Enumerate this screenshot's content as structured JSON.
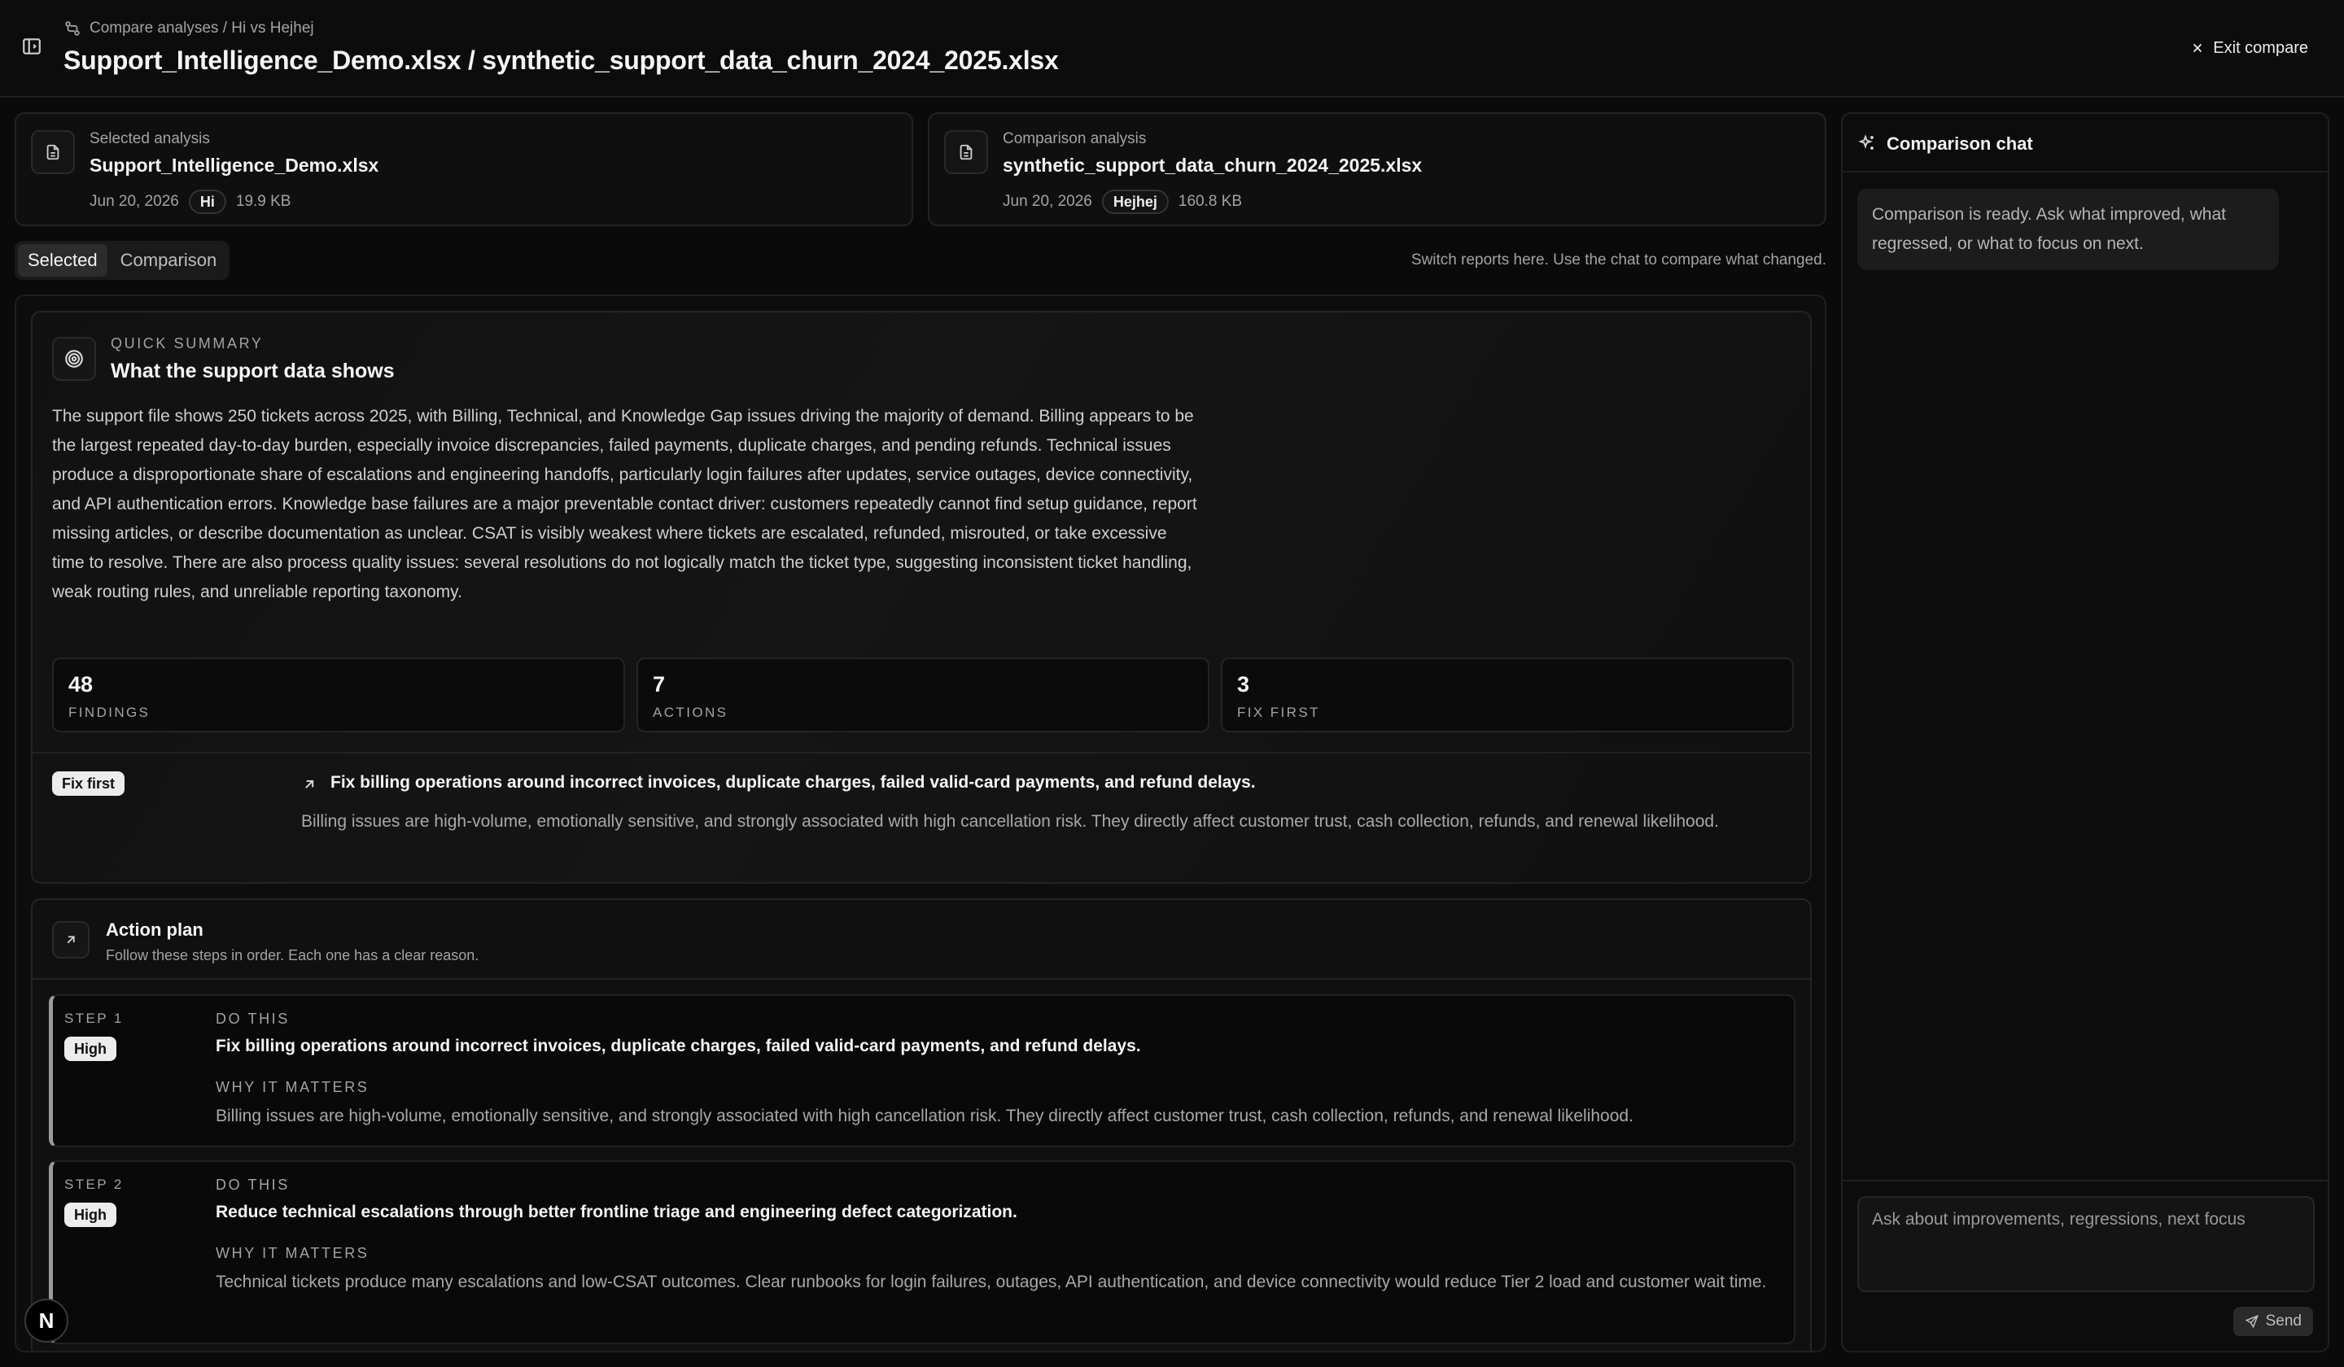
{
  "header": {
    "breadcrumb": "Compare analyses / Hi vs Hejhej",
    "title": "Support_Intelligence_Demo.xlsx / synthetic_support_data_churn_2024_2025.xlsx",
    "exit_label": "Exit compare"
  },
  "selected_analysis": {
    "kind": "Selected analysis",
    "file_name": "Support_Intelligence_Demo.xlsx",
    "date": "Jun 20, 2026",
    "tag": "Hi",
    "size": "19.9 KB"
  },
  "comparison_analysis": {
    "kind": "Comparison analysis",
    "file_name": "synthetic_support_data_churn_2024_2025.xlsx",
    "date": "Jun 20, 2026",
    "tag": "Hejhej",
    "size": "160.8 KB"
  },
  "tabs": {
    "selected": "Selected",
    "comparison": "Comparison",
    "active": "Selected",
    "hint": "Switch reports here. Use the chat to compare what changed."
  },
  "summary": {
    "eyebrow": "QUICK SUMMARY",
    "title": "What the support data shows",
    "body": "The support file shows 250 tickets across 2025, with Billing, Technical, and Knowledge Gap issues driving the majority of demand. Billing appears to be the largest repeated day-to-day burden, especially invoice discrepancies, failed payments, duplicate charges, and pending refunds. Technical issues produce a disproportionate share of escalations and engineering handoffs, particularly login failures after updates, service outages, device connectivity, and API authentication errors. Knowledge base failures are a major preventable contact driver: customers repeatedly cannot find setup guidance, report missing articles, or describe documentation as unclear. CSAT is visibly weakest where tickets are escalated, refunded, misrouted, or take excessive time to resolve. There are also process quality issues: several resolutions do not logically match the ticket type, suggesting inconsistent ticket handling, weak routing rules, and unreliable reporting taxonomy.",
    "stats": [
      {
        "value": "48",
        "label": "FINDINGS"
      },
      {
        "value": "7",
        "label": "ACTIONS"
      },
      {
        "value": "3",
        "label": "FIX FIRST"
      }
    ],
    "fix_first": {
      "badge": "Fix first",
      "title": "Fix billing operations around incorrect invoices, duplicate charges, failed valid-card payments, and refund delays.",
      "body": "Billing issues are high-volume, emotionally sensitive, and strongly associated with high cancellation risk. They directly affect customer trust, cash collection, refunds, and renewal likelihood."
    }
  },
  "action_plan": {
    "title": "Action plan",
    "subtitle": "Follow these steps in order. Each one has a clear reason.",
    "do_label": "DO THIS",
    "why_label": "WHY IT MATTERS",
    "steps": [
      {
        "step": "STEP 1",
        "priority": "High",
        "action": "Fix billing operations around incorrect invoices, duplicate charges, failed valid-card payments, and refund delays.",
        "reason": "Billing issues are high-volume, emotionally sensitive, and strongly associated with high cancellation risk. They directly affect customer trust, cash collection, refunds, and renewal likelihood."
      },
      {
        "step": "STEP 2",
        "priority": "High",
        "action": "Reduce technical escalations through better frontline triage and engineering defect categorization.",
        "reason": "Technical tickets produce many escalations and low-CSAT outcomes. Clear runbooks for login failures, outages, API authentication, and device connectivity would reduce Tier 2 load and customer wait time."
      }
    ]
  },
  "chat": {
    "title": "Comparison chat",
    "message": "Comparison is ready. Ask what improved, what regressed, or what to focus on next.",
    "placeholder": "Ask about improvements, regressions, next focus",
    "send_label": "Send"
  },
  "badge": {
    "letter": "N"
  },
  "icons": {
    "sidebar_toggle": "sidebar-toggle-icon",
    "compare": "compare-icon",
    "close": "close-icon",
    "document": "document-icon",
    "target": "target-icon",
    "arrow": "arrow-up-right-icon",
    "sparkle": "sparkle-icon",
    "send": "send-icon"
  },
  "colors": {
    "background": "#0a0a0a",
    "panel": "#0d0d0d",
    "border": "#242424",
    "text": "#ededed",
    "muted": "#a3a3a3",
    "badge_bg": "#ececec"
  }
}
